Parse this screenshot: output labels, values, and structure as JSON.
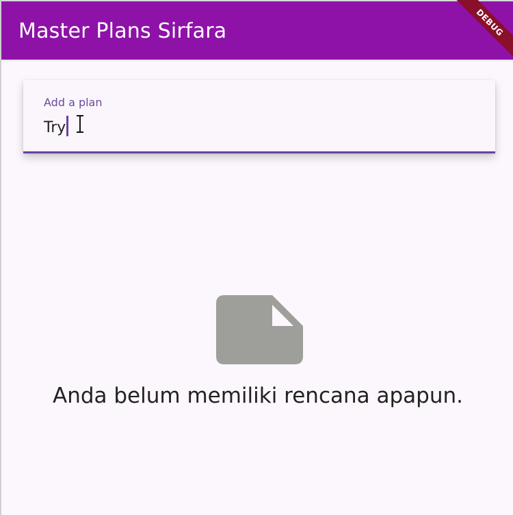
{
  "app_bar": {
    "title": "Master Plans Sirfara",
    "debug_banner": "DEBUG",
    "color": "#8e12a8"
  },
  "plan_input": {
    "label": "Add a plan",
    "value": "Try",
    "accent_color": "#6a3fa8"
  },
  "empty_state": {
    "icon": "note-icon",
    "message": "Anda belum memiliki rencana apapun."
  }
}
